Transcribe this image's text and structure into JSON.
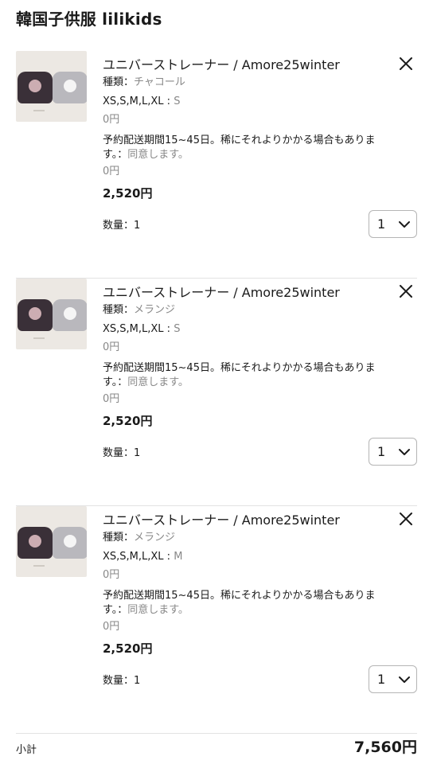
{
  "shop": {
    "title": "韓国子供服 lilikids"
  },
  "items": [
    {
      "name": "ユニバーストレーナー / Amore25winter",
      "variant_label": "種類：",
      "variant_value": "チャコール",
      "size_label": "XS,S,M,L,XL : ",
      "size_value": "S",
      "size_price": "0円",
      "note_label": "予約配送期間15~45日。稀にそれよりかかる場合もあります。：",
      "note_value": "同意します。",
      "note_price": "0円",
      "price": "2,520円",
      "qty_label": "数量：1",
      "qty_value": "1",
      "remove_icon": "close-icon",
      "qty_icon": "chevron-down-icon"
    },
    {
      "name": "ユニバーストレーナー / Amore25winter",
      "variant_label": "種類：",
      "variant_value": "メランジ",
      "size_label": "XS,S,M,L,XL : ",
      "size_value": "S",
      "size_price": "0円",
      "note_label": "予約配送期間15~45日。稀にそれよりかかる場合もあります。：",
      "note_value": "同意します。",
      "note_price": "0円",
      "price": "2,520円",
      "qty_label": "数量：1",
      "qty_value": "1",
      "remove_icon": "close-icon",
      "qty_icon": "chevron-down-icon"
    },
    {
      "name": "ユニバーストレーナー / Amore25winter",
      "variant_label": "種類：",
      "variant_value": "メランジ",
      "size_label": "XS,S,M,L,XL : ",
      "size_value": "M",
      "size_price": "0円",
      "note_label": "予約配送期間15~45日。稀にそれよりかかる場合もあります。：",
      "note_value": "同意します。",
      "note_price": "0円",
      "price": "2,520円",
      "qty_label": "数量：1",
      "qty_value": "1",
      "remove_icon": "close-icon",
      "qty_icon": "chevron-down-icon"
    }
  ],
  "subtotal": {
    "label": "小計",
    "value": "7,560円"
  },
  "colors": {
    "text": "#1a1a1a",
    "muted": "#888888",
    "divider": "#e2e2e2",
    "select_border": "#b5b5b5"
  }
}
